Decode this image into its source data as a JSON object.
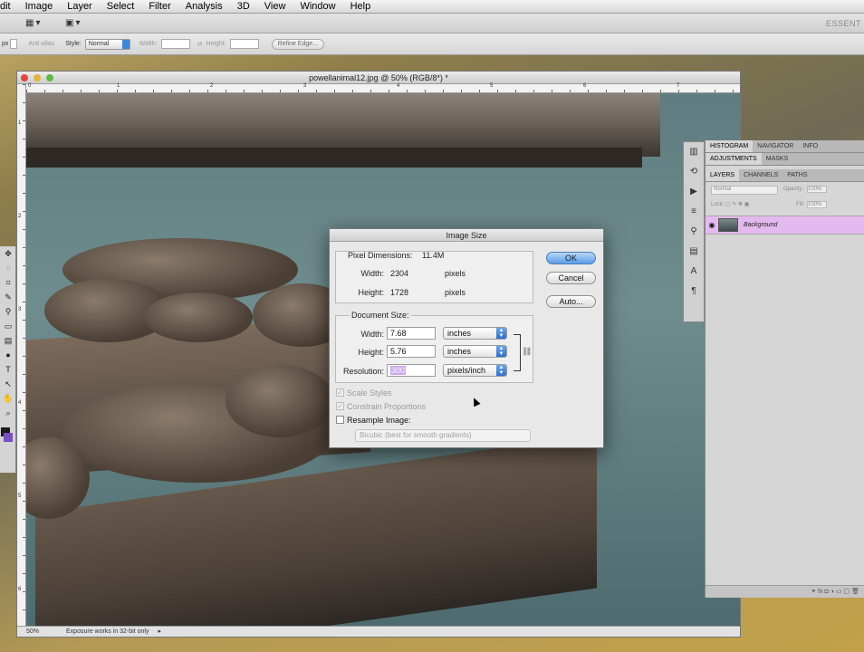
{
  "menubar": {
    "items": [
      "dit",
      "Image",
      "Layer",
      "Select",
      "Filter",
      "Analysis",
      "3D",
      "View",
      "Window",
      "Help"
    ]
  },
  "appbar": {
    "essentials": "ESSENT"
  },
  "options": {
    "px_label": "px",
    "antialias": "Anti-alias",
    "style_label": "Style:",
    "style_value": "Normal",
    "width_label": "Width:",
    "height_label": "Height:",
    "refine_edge": "Refine Edge..."
  },
  "document": {
    "title": "powellanimal12.jpg @ 50% (RGB/8*) *",
    "ruler_top": [
      "0",
      "1",
      "2",
      "3",
      "4",
      "5",
      "6",
      "7"
    ],
    "ruler_left": [
      "1",
      "2",
      "3",
      "4",
      "5",
      "6"
    ],
    "zoom": "50%",
    "status": "Exposure works in 32-bit only"
  },
  "panels": {
    "top_tabs": [
      "HISTOGRAM",
      "NAVIGATOR",
      "INFO"
    ],
    "mid_tabs": [
      "ADJUSTMENTS",
      "MASKS"
    ],
    "layer_tabs": [
      "LAYERS",
      "CHANNELS",
      "PATHS"
    ],
    "blend_mode": "Normal",
    "opacity_label": "Opacity:",
    "opacity_value": "100%",
    "lock_label": "Lock:",
    "fill_label": "Fill:",
    "fill_value": "100%",
    "layer_name": "Background"
  },
  "dialog": {
    "title": "Image Size",
    "pixel_dimensions_label": "Pixel Dimensions:",
    "pixel_dimensions_value": "11.4M",
    "px_width_label": "Width:",
    "px_width_value": "2304",
    "px_width_unit": "pixels",
    "px_height_label": "Height:",
    "px_height_value": "1728",
    "px_height_unit": "pixels",
    "document_size_label": "Document Size:",
    "doc_width_label": "Width:",
    "doc_width_value": "7.68",
    "doc_width_unit": "inches",
    "doc_height_label": "Height:",
    "doc_height_value": "5.76",
    "doc_height_unit": "inches",
    "resolution_label": "Resolution:",
    "resolution_value": "300",
    "resolution_unit": "pixels/inch",
    "scale_styles": "Scale Styles",
    "constrain_proportions": "Constrain Proportions",
    "resample_image": "Resample Image:",
    "resample_method": "Bicubic (best for smooth gradients)",
    "ok": "OK",
    "cancel": "Cancel",
    "auto": "Auto..."
  }
}
